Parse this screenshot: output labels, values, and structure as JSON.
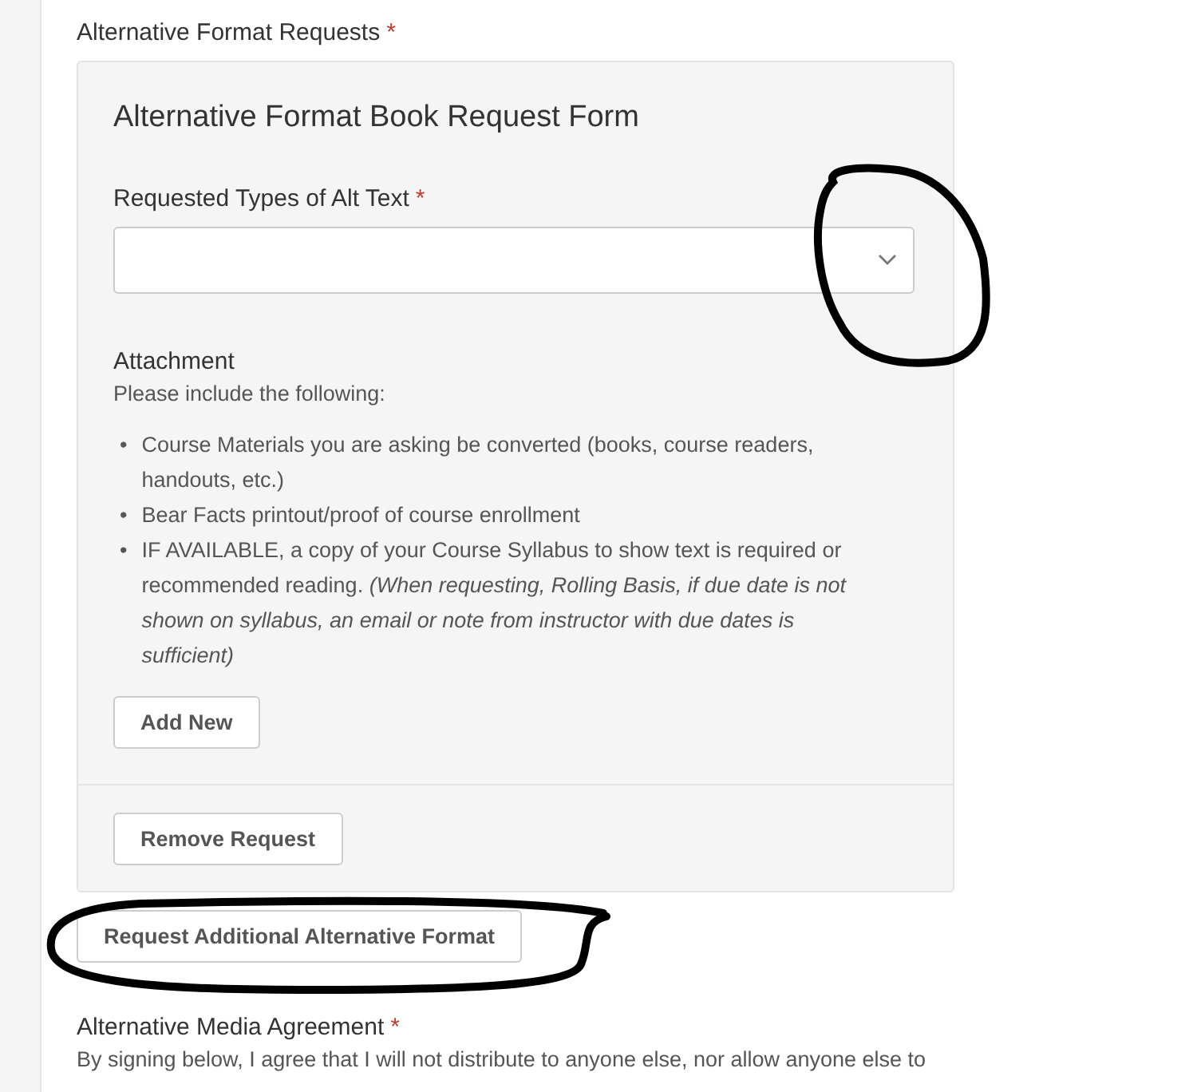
{
  "section_label": {
    "text": "Alternative Format Requests",
    "required_mark": "*"
  },
  "request_form": {
    "title": "Alternative Format Book Request Form",
    "select_field": {
      "label": "Requested Types of Alt Text",
      "required_mark": "*"
    },
    "attachment": {
      "label": "Attachment",
      "hint": "Please include the following:",
      "marker": "•",
      "items": [
        "Course Materials you are asking be converted (books, course readers, handouts, etc.)",
        "Bear Facts printout/proof of course enrollment",
        "IF AVAILABLE, a copy of your Course Syllabus to show text is required or recommended reading. *(When requesting, Rolling Basis, if due date is not shown on syllabus, an email or note from instructor with due dates is sufficient)*"
      ],
      "add_button": "Add New"
    },
    "remove_button": "Remove Request"
  },
  "add_request_button": "Request Additional Alternative Format",
  "agreement": {
    "label": "Alternative Media Agreement",
    "required_mark": "*",
    "text": "By signing below, I agree that I will not distribute to anyone else, nor allow anyone else to"
  }
}
